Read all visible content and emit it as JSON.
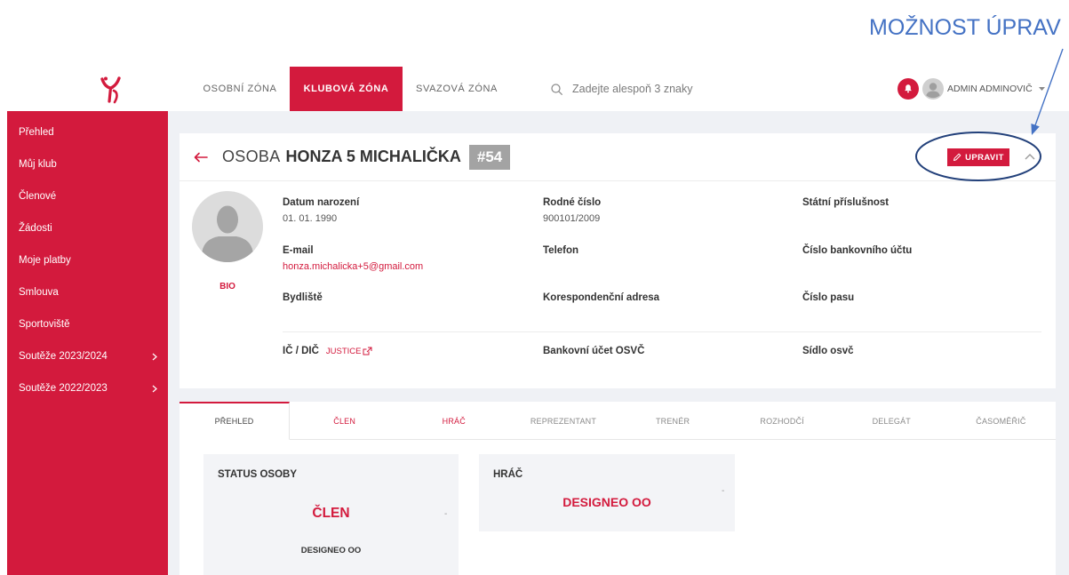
{
  "annotation": {
    "text": "MOŽNOST ÚPRAV"
  },
  "colors": {
    "primary": "#d31a3d",
    "page_background": "#eff1f5",
    "annotation": "#4472c4",
    "annotation_outline": "#22407a",
    "badge": "#a3a3a3"
  },
  "header": {
    "logo_icon": "handball-logo-icon",
    "nav": [
      {
        "label": "OSOBNÍ ZÓNA",
        "active": false
      },
      {
        "label": "KLUBOVÁ ZÓNA",
        "active": true
      },
      {
        "label": "SVAZOVÁ ZÓNA",
        "active": false
      }
    ],
    "search": {
      "icon": "search-icon",
      "placeholder": "Zadejte alespoň 3 znaky"
    },
    "notifications": {
      "icon": "bell-icon"
    },
    "user": {
      "avatar_icon": "user-avatar-icon",
      "name": "ADMIN ADMINOVIČ",
      "dropdown_icon": "caret-down-icon"
    }
  },
  "sidebar": {
    "items": [
      {
        "label": "Přehled"
      },
      {
        "label": "Můj klub"
      },
      {
        "label": "Členové"
      },
      {
        "label": "Žádosti"
      },
      {
        "label": "Moje platby"
      },
      {
        "label": "Smlouva"
      },
      {
        "label": "Sportoviště"
      },
      {
        "label": "Soutěže 2023/2024",
        "submenu_icon": "chevron-right-icon"
      },
      {
        "label": "Soutěže 2022/2023",
        "submenu_icon": "chevron-right-icon"
      }
    ]
  },
  "person": {
    "back_icon": "arrow-left-icon",
    "title_prefix": "OSOBA",
    "name": "HONZA 5 MICHALIČKA",
    "number": "#54",
    "edit_button": {
      "icon": "pencil-icon",
      "label": "UPRAVIT"
    },
    "collapse_icon": "chevron-up-icon",
    "photo_icon": "person-silhouette-icon",
    "bio_link": "BIO",
    "details": {
      "birth_date": {
        "label": "Datum narození",
        "value": "01. 01. 1990"
      },
      "birth_number": {
        "label": "Rodné číslo",
        "value": "900101/2009"
      },
      "citizenship": {
        "label": "Státní příslušnost"
      },
      "email": {
        "label": "E-mail",
        "value": "honza.michalicka+5@gmail.com"
      },
      "phone": {
        "label": "Telefon"
      },
      "bank_account": {
        "label": "Číslo bankovního účtu"
      },
      "address": {
        "label": "Bydliště"
      },
      "correspondence_address": {
        "label": "Korespondenční adresa"
      },
      "passport": {
        "label": "Číslo pasu"
      },
      "ico_dic": {
        "label": "IČ / DIČ",
        "link": "JUSTICE",
        "link_icon": "external-link-icon"
      },
      "osvc_bank_account": {
        "label": "Bankovní účet OSVČ"
      },
      "osvc_seat": {
        "label": "Sídlo osvč"
      }
    }
  },
  "tabs": [
    {
      "label": "PŘEHLED",
      "active": true
    },
    {
      "label": "ČLEN",
      "highlighted": true
    },
    {
      "label": "HRÁČ",
      "highlighted": true
    },
    {
      "label": "REPREZENTANT"
    },
    {
      "label": "TRENÉR"
    },
    {
      "label": "ROZHODČÍ"
    },
    {
      "label": "DELEGÁT"
    },
    {
      "label": "ČASOMĚŘIČ"
    }
  ],
  "overview": {
    "status_card": {
      "title": "STATUS OSOBY",
      "role": "ČLEN",
      "dash": "-",
      "club": "DESIGNEO OO"
    },
    "player_card": {
      "title": "HRÁČ",
      "club": "DESIGNEO OO",
      "dash": "-"
    }
  }
}
